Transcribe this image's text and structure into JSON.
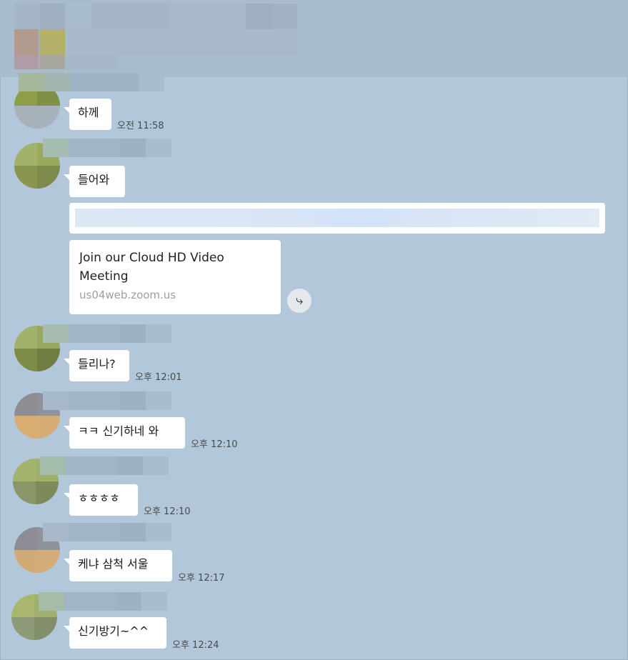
{
  "colors": {
    "background": "#b2c7d9",
    "bubble": "#ffffff",
    "time_text": "#4a4a4a",
    "link_url": "#9e9e9e"
  },
  "messages": [
    {
      "text": "하께",
      "time": "오전 11:58"
    },
    {
      "text": "들어와"
    },
    {
      "text": "들리나?",
      "time": "오후 12:01"
    },
    {
      "text": "ㅋㅋ 신기하네 와",
      "time": "오후 12:10"
    },
    {
      "text": "ㅎㅎㅎㅎ",
      "time": "오후 12:10"
    },
    {
      "text": "케냐 삼척 서울",
      "time": "오후 12:17"
    },
    {
      "text": "신기방기~^^",
      "time": "오후 12:24"
    }
  ],
  "link_preview": {
    "title": "Join our Cloud HD Video Meeting",
    "domain": "us04web.zoom.us",
    "share_icon": "share-arrow-icon"
  }
}
